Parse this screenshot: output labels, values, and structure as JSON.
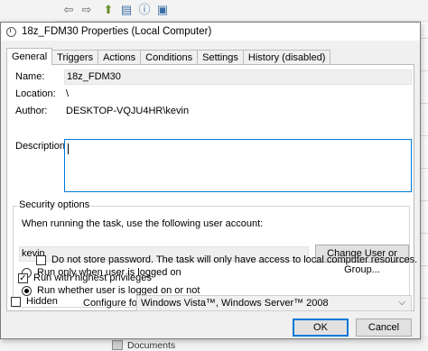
{
  "dialog": {
    "title": "18z_FDM30 Properties (Local Computer)",
    "tabs": [
      "General",
      "Triggers",
      "Actions",
      "Conditions",
      "Settings",
      "History (disabled)"
    ],
    "active_tab": "General"
  },
  "general": {
    "name_label": "Name:",
    "name_value": "18z_FDM30",
    "location_label": "Location:",
    "location_value": "\\",
    "author_label": "Author:",
    "author_value": "DESKTOP-VQJU4HR\\kevin",
    "description_label": "Description:",
    "description_value": ""
  },
  "security": {
    "title": "Security options",
    "account_prompt": "When running the task, use the following user account:",
    "account_value": "kevin",
    "change_button": "Change User or Group...",
    "radio_logged_on": "Run only when user is logged on",
    "radio_whether": "Run whether user is logged on or not",
    "selected_radio": "whether",
    "no_store_password": "Do not store password.  The task will only have access to local computer resources.",
    "no_store_password_checked": false,
    "highest_privileges": "Run with highest privileges",
    "highest_privileges_checked": true
  },
  "footer": {
    "hidden_label": "Hidden",
    "hidden_checked": false,
    "configure_label": "Configure for:",
    "configure_value": "Windows Vista™, Windows Server™ 2008",
    "ok": "OK",
    "cancel": "Cancel"
  },
  "background": {
    "documents_label": "Documents",
    "icons": [
      "back-arrow-icon",
      "forward-arrow-icon",
      "folder-up-icon",
      "properties-icon",
      "help-icon",
      "page-icon"
    ]
  }
}
